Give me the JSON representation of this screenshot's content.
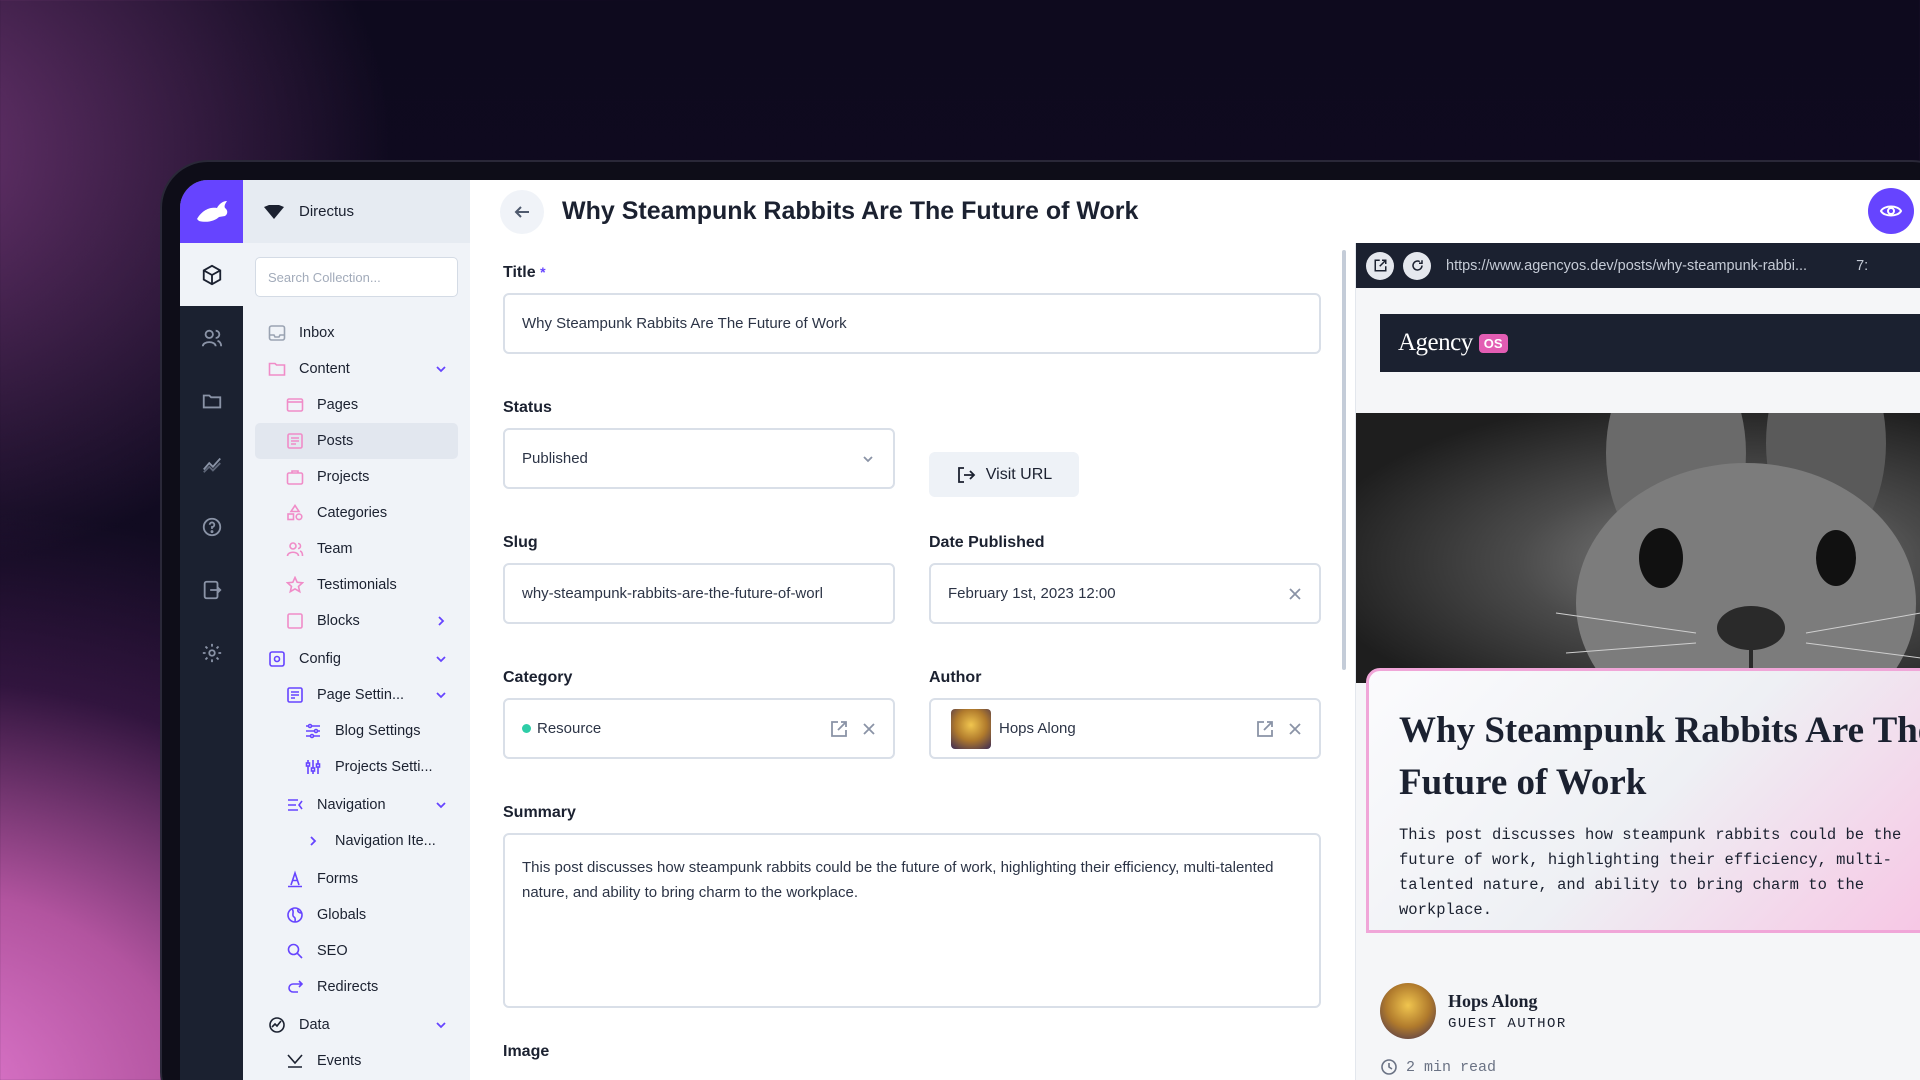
{
  "project": {
    "name": "Directus"
  },
  "search": {
    "placeholder": "Search Collection..."
  },
  "nav": {
    "inbox": "Inbox",
    "content": "Content",
    "pages": "Pages",
    "posts": "Posts",
    "projects": "Projects",
    "categories": "Categories",
    "team": "Team",
    "testimonials": "Testimonials",
    "blocks": "Blocks",
    "config": "Config",
    "page_settings": "Page Settin...",
    "blog_settings": "Blog Settings",
    "projects_settings": "Projects Setti...",
    "navigation": "Navigation",
    "navigation_items": "Navigation Ite...",
    "forms": "Forms",
    "globals": "Globals",
    "seo": "SEO",
    "redirects": "Redirects",
    "data": "Data",
    "events": "Events"
  },
  "header": {
    "title": "Why Steampunk Rabbits Are The Future of Work"
  },
  "form": {
    "title_label": "Title",
    "title_required": "*",
    "title_value": "Why Steampunk Rabbits Are The Future of Work",
    "status_label": "Status",
    "status_value": "Published",
    "visit_url_label": "Visit URL",
    "slug_label": "Slug",
    "slug_value": "why-steampunk-rabbits-are-the-future-of-worl",
    "date_label": "Date Published",
    "date_value": "February 1st, 2023 12:00",
    "category_label": "Category",
    "category_value": "Resource",
    "author_label": "Author",
    "author_value": "Hops Along",
    "summary_label": "Summary",
    "summary_value": "This post discusses how steampunk rabbits could be the future of work, highlighting their efficiency, multi-talented nature, and ability to bring charm to the workplace.",
    "image_label": "Image"
  },
  "preview": {
    "url": "https://www.agencyos.dev/posts/why-steampunk-rabbi...",
    "zoom": "7:",
    "brand": "Agency",
    "brand_badge": "OS",
    "post_title": "Why Steampunk Rabbits Are The Future of Work",
    "post_summary": "This post discusses how steampunk rabbits could be the future of work, highlighting their efficiency, multi-talented nature, and ability to bring charm to the workplace.",
    "author_name": "Hops Along",
    "author_role": "GUEST AUTHOR",
    "read_time": "2 min read"
  },
  "colors": {
    "accent": "#6644ff",
    "rail": "#1b2130",
    "pink": "#e35db3",
    "green": "#2ecda7"
  }
}
